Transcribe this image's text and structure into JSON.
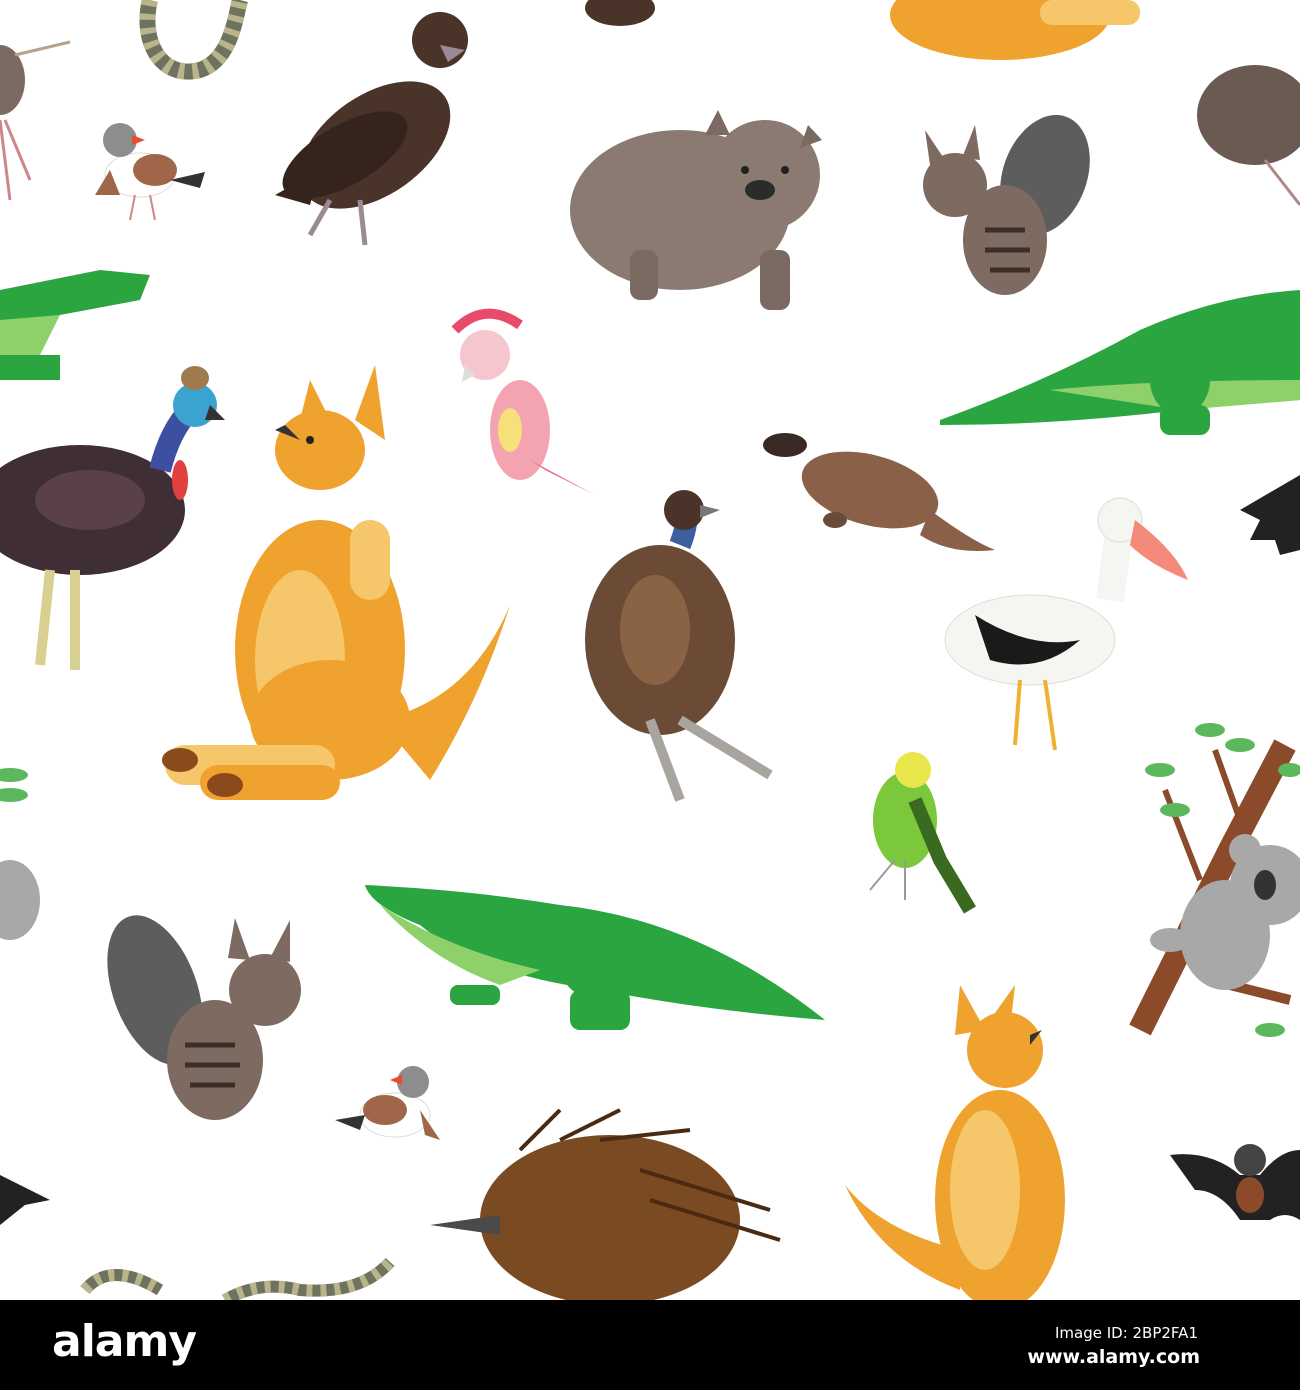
{
  "watermark": {
    "logo": "alamy",
    "image_id": "Image ID: 2BP2FA1",
    "url": "www.alamy.com"
  },
  "colors": {
    "kangaroo": "#f0a22e",
    "crocodile": "#2aa540",
    "wombat": "#8a7a72",
    "emu": "#6b4a36",
    "platypus": "#8a6148",
    "background": "#ffffff",
    "footer": "#000000"
  }
}
